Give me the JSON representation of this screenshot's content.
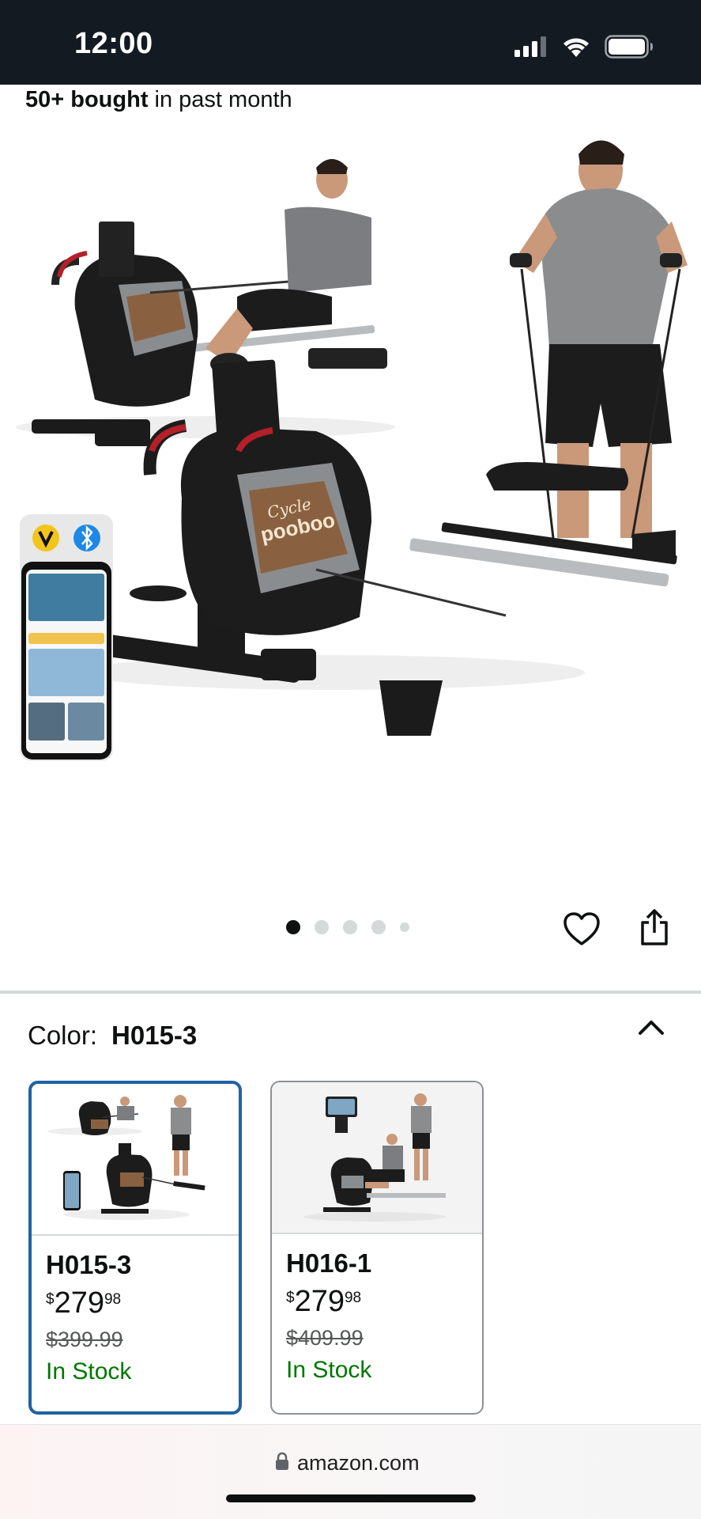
{
  "status_bar": {
    "time": "12:00",
    "icons": [
      "signal-icon",
      "wifi-icon",
      "battery-icon"
    ]
  },
  "social_proof": {
    "count": "50+ bought",
    "suffix": " in past month"
  },
  "product_image": {
    "brand_text_top": "Cycle",
    "brand_text_bottom": "pooboo",
    "carousel": {
      "total": 5,
      "active_index": 0
    }
  },
  "actions": {
    "icons": [
      "heart-icon",
      "share-icon"
    ]
  },
  "color_selector": {
    "label": "Color:",
    "value": "H015-3"
  },
  "swatches": [
    {
      "name": "H015-3",
      "price_currency": "$",
      "price_whole": "279",
      "price_fraction": "98",
      "list_price": "$399.99",
      "stock": "In Stock",
      "selected": true
    },
    {
      "name": "H016-1",
      "price_currency": "$",
      "price_whole": "279",
      "price_fraction": "98",
      "list_price": "$409.99",
      "stock": "In Stock",
      "selected": false
    }
  ],
  "browser": {
    "url": "amazon.com"
  },
  "colors": {
    "status_bar_bg": "#131a22",
    "selected_border": "#2162a1",
    "in_stock": "#007600"
  }
}
